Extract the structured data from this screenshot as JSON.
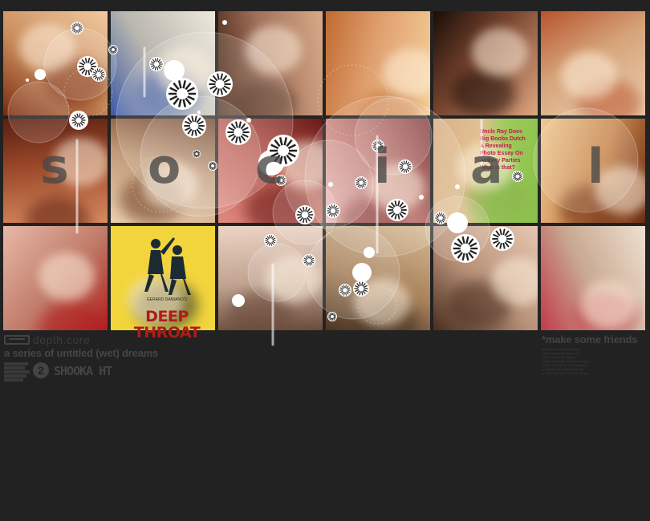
{
  "page": {
    "background": "#222222"
  },
  "letters": [
    "s",
    "o",
    "c",
    "i",
    "a",
    "l"
  ],
  "tiles": [
    {
      "name": "tile-redhead-portrait",
      "base": "#c88a5a",
      "accent": "#7a2a10",
      "hl": "#f2c9a0"
    },
    {
      "name": "tile-striped-swimsuit",
      "base": "#b9b6ae",
      "accent": "#3c5aa8",
      "hl": "#eee8dc"
    },
    {
      "name": "tile-bare-chest-man",
      "base": "#a0705a",
      "accent": "#4a2a1a",
      "hl": "#d8aa88"
    },
    {
      "name": "tile-skin-closeup",
      "base": "#e0a070",
      "accent": "#c06a30",
      "hl": "#f5d29a"
    },
    {
      "name": "tile-dark-hair-woman",
      "base": "#7a4630",
      "accent": "#1a0d08",
      "hl": "#e0a680"
    },
    {
      "name": "tile-orange-race-car",
      "base": "#d6a47a",
      "accent": "#b8532c",
      "hl": "#ebd0b0"
    },
    {
      "name": "tile-warm-portrait",
      "base": "#9c4a2a",
      "accent": "#5a1e10",
      "hl": "#d88a60"
    },
    {
      "name": "tile-smiling-blonde",
      "base": "#c09a78",
      "accent": "#6a3a22",
      "hl": "#ecd0b0"
    },
    {
      "name": "tile-red-group",
      "base": "#b45448",
      "accent": "#6a1a1a",
      "hl": "#e08a80"
    },
    {
      "name": "tile-red-figure",
      "base": "#b8706a",
      "accent": "#7a2a2a",
      "hl": "#e6b0a8"
    },
    {
      "name": "tile-magazine-cover",
      "base": "#d8c080",
      "accent": "#8ab050",
      "hl": "#f2e6b0"
    },
    {
      "name": "tile-curly-blonde",
      "base": "#c88850",
      "accent": "#6a2a10",
      "hl": "#f0c890"
    },
    {
      "name": "tile-red-bikini",
      "base": "#c07a68",
      "accent": "#b01e1e",
      "hl": "#e8b8a8"
    },
    {
      "name": "tile-movie-poster",
      "base": "#f0d23a",
      "accent": "#1a2a30",
      "hl": "#fff4a0"
    },
    {
      "name": "tile-pale-figure",
      "base": "#c0a290",
      "accent": "#6a4a3a",
      "hl": "#ecd4c4"
    },
    {
      "name": "tile-rocky-shore",
      "base": "#a6805a",
      "accent": "#4a3422",
      "hl": "#d8bc98"
    },
    {
      "name": "tile-sunglasses-hand",
      "base": "#b89078",
      "accent": "#4a2e20",
      "hl": "#e6c8b0"
    },
    {
      "name": "tile-gingham-bikini",
      "base": "#c8a890",
      "accent": "#c03a4a",
      "hl": "#eee0d0"
    }
  ],
  "magazine": {
    "lines": [
      "Uncle Ray Does",
      "Big Boobs Dutch",
      "A Revealing",
      "Photo Essay On",
      "Activity Parties",
      "",
      "What is that?"
    ]
  },
  "poster": {
    "credit_line": "GERARD DAMIANO'S",
    "title": "DEEP THROAT"
  },
  "footer_left": {
    "brand": "depth.core",
    "title": "a series of untitled (wet) dreams",
    "disc_number": "2",
    "artist": "SHOOKA HT",
    "credits": [
      "",
      "",
      "",
      "",
      "",
      ""
    ]
  },
  "footer_right": {
    "tagline": "*make some friends",
    "lines": [
      "fall and rinse repeat, bring",
      "dollar young, fan and more",
      "where can more fingers",
      "kiddie can smile, smile can smell,",
      "a hall of hands do, or sandbath,",
      "or session will softness thrills,",
      "or rather, abortion and the young."
    ]
  },
  "colors": {
    "bubble": "#ffffff",
    "letter": "#464646"
  }
}
